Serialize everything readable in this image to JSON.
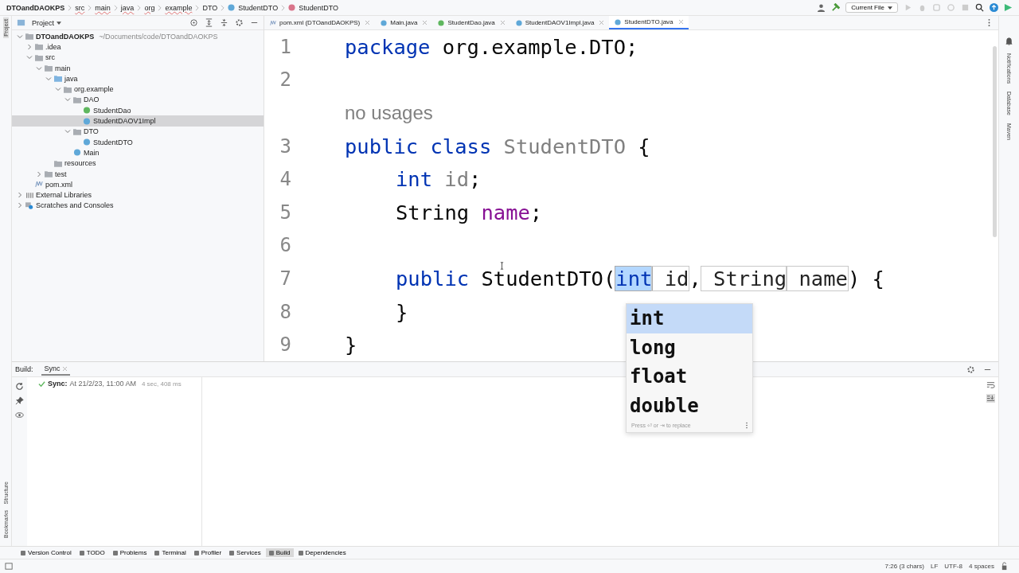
{
  "breadcrumbs": [
    {
      "label": "DTOandDAOKPS",
      "kind": "project"
    },
    {
      "label": "src",
      "kind": "folder"
    },
    {
      "label": "main",
      "kind": "folder"
    },
    {
      "label": "java",
      "kind": "folder"
    },
    {
      "label": "org",
      "kind": "folder"
    },
    {
      "label": "example",
      "kind": "folder"
    },
    {
      "label": "DTO",
      "kind": "package"
    },
    {
      "label": "StudentDTO",
      "kind": "class"
    },
    {
      "label": "StudentDTO",
      "kind": "method"
    }
  ],
  "run_config": "Current File",
  "left_strip": {
    "top": "Project",
    "bottom": [
      "Structure",
      "Bookmarks"
    ]
  },
  "right_strip": [
    "Notifications",
    "Database",
    "Maven"
  ],
  "project_panel": {
    "title": "Project",
    "tree": [
      {
        "label": "DTOandDAOKPS",
        "kind": "module",
        "expanded": true,
        "selected": false,
        "note": "~/Documents/code/DTOandDAOKPS",
        "children": [
          {
            "label": ".idea",
            "kind": "folder",
            "expanded": false,
            "selected": false
          },
          {
            "label": "src",
            "kind": "folder",
            "expanded": true,
            "selected": false,
            "children": [
              {
                "label": "main",
                "kind": "folder",
                "expanded": true,
                "selected": false,
                "children": [
                  {
                    "label": "java",
                    "kind": "source",
                    "expanded": true,
                    "selected": false,
                    "children": [
                      {
                        "label": "org.example",
                        "kind": "package",
                        "expanded": true,
                        "selected": false,
                        "children": [
                          {
                            "label": "DAO",
                            "kind": "package",
                            "expanded": true,
                            "selected": false,
                            "children": [
                              {
                                "label": "StudentDao",
                                "kind": "interface",
                                "selected": false
                              },
                              {
                                "label": "StudentDAOV1Impl",
                                "kind": "class",
                                "selected": true
                              }
                            ]
                          },
                          {
                            "label": "DTO",
                            "kind": "package",
                            "expanded": true,
                            "selected": false,
                            "children": [
                              {
                                "label": "StudentDTO",
                                "kind": "class",
                                "selected": false
                              }
                            ]
                          },
                          {
                            "label": "Main",
                            "kind": "main",
                            "selected": false
                          }
                        ]
                      }
                    ]
                  },
                  {
                    "label": "resources",
                    "kind": "resources",
                    "selected": false
                  }
                ]
              },
              {
                "label": "test",
                "kind": "folder",
                "expanded": false,
                "selected": false
              }
            ]
          },
          {
            "label": "pom.xml",
            "kind": "maven",
            "selected": false
          }
        ]
      },
      {
        "label": "External Libraries",
        "kind": "libraries",
        "expanded": false,
        "selected": false
      },
      {
        "label": "Scratches and Consoles",
        "kind": "scratches",
        "expanded": false,
        "selected": false
      }
    ]
  },
  "tabs": [
    {
      "label": "pom.xml (DTOandDAOKPS)",
      "kind": "maven",
      "selected": false
    },
    {
      "label": "Main.java",
      "kind": "class",
      "selected": false
    },
    {
      "label": "StudentDao.java",
      "kind": "interface",
      "selected": false
    },
    {
      "label": "StudentDAOV1Impl.java",
      "kind": "class",
      "selected": false
    },
    {
      "label": "StudentDTO.java",
      "kind": "class",
      "selected": true
    }
  ],
  "editor": {
    "lines": [
      {
        "kind": "top",
        "number": "1",
        "tokens": [
          {
            "text": "package",
            "kind": "keyword",
            "space_before": false
          },
          {
            "text": "org.example.DTO;",
            "kind": "plain",
            "space_before": true
          }
        ]
      },
      {
        "kind": "top",
        "number": "2"
      },
      {
        "kind": "hint",
        "text": "no usages"
      },
      {
        "kind": "top",
        "number": "3",
        "tokens": [
          {
            "text": "public class",
            "kind": "keyword",
            "space_before": false
          },
          {
            "text": "StudentDTO",
            "kind": "unused",
            "space_before": true
          },
          {
            "text": "{",
            "kind": "plain",
            "space_before": true
          }
        ]
      },
      {
        "kind": "member",
        "number": "4",
        "tokens": [
          {
            "text": "int",
            "kind": "keyword",
            "space_before": false
          },
          {
            "text": "id",
            "kind": "unused",
            "space_before": true
          },
          {
            "text": ";",
            "kind": "plain",
            "space_before": false
          }
        ]
      },
      {
        "kind": "member",
        "number": "5",
        "tokens": [
          {
            "text": "String",
            "kind": "plain",
            "space_before": false
          },
          {
            "text": "name",
            "kind": "field",
            "space_before": true
          },
          {
            "text": ";",
            "kind": "plain",
            "space_before": false
          }
        ]
      },
      {
        "kind": "top",
        "number": "6"
      },
      {
        "kind": "member",
        "number": "7",
        "tokens": [
          {
            "text": "public",
            "kind": "keyword",
            "space_before": false
          },
          {
            "text": "StudentDTO(",
            "kind": "plain",
            "space_before": true
          },
          {
            "text": "int",
            "kind": "selected",
            "space_before": false
          },
          {
            "text": "id",
            "kind": "template",
            "space_before": true
          },
          {
            "text": ",",
            "kind": "plain",
            "space_before": false
          },
          {
            "text": "String",
            "kind": "template",
            "space_before": true
          },
          {
            "text": "name",
            "kind": "template",
            "space_before": true
          },
          {
            "text": ") {",
            "kind": "plain",
            "space_before": false
          }
        ]
      },
      {
        "kind": "member",
        "number": "8",
        "tokens": [
          {
            "text": "}",
            "kind": "plain",
            "space_before": false
          }
        ]
      },
      {
        "kind": "top",
        "number": "9",
        "tokens": [
          {
            "text": "}",
            "kind": "plain",
            "space_before": false
          }
        ]
      }
    ]
  },
  "completion": {
    "items": [
      {
        "label": "int",
        "selected": true
      },
      {
        "label": "long",
        "selected": false
      },
      {
        "label": "float",
        "selected": false
      },
      {
        "label": "double",
        "selected": false
      }
    ],
    "footer": "Press ⏎ or ⇥ to replace"
  },
  "build": {
    "label": "Build:",
    "tab": "Sync",
    "entry": {
      "title": "Sync:",
      "text": "At 21/2/23, 11:00 AM",
      "duration": "4 sec, 408 ms"
    }
  },
  "tool_tabs": [
    {
      "label": "Version Control",
      "selected": false
    },
    {
      "label": "TODO",
      "selected": false
    },
    {
      "label": "Problems",
      "selected": false
    },
    {
      "label": "Terminal",
      "selected": false
    },
    {
      "label": "Profiler",
      "selected": false
    },
    {
      "label": "Services",
      "selected": false
    },
    {
      "label": "Build",
      "selected": true
    },
    {
      "label": "Dependencies",
      "selected": false
    }
  ],
  "status": [
    "7:26 (3 chars)",
    "LF",
    "UTF-8",
    "4 spaces"
  ]
}
